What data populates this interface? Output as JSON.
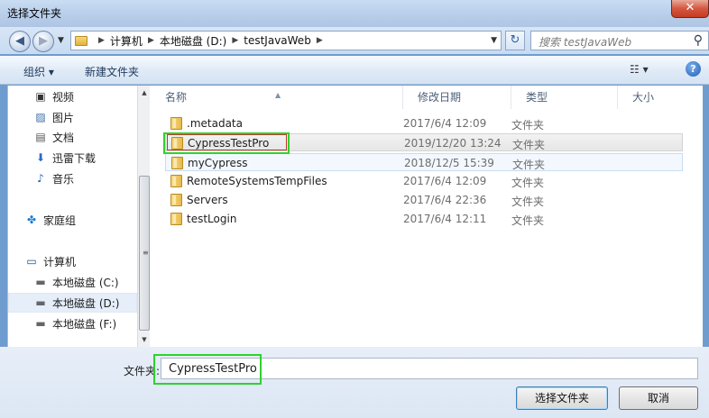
{
  "window": {
    "title": "选择文件夹",
    "close_label": "✕"
  },
  "navigation": {
    "breadcrumbs": [
      "计算机",
      "本地磁盘 (D:)",
      "testJavaWeb"
    ],
    "search_placeholder": "搜索 testJavaWeb"
  },
  "toolbar": {
    "organize_label": "组织 ▾",
    "new_folder_label": "新建文件夹",
    "view_label": "☷ ▾",
    "help_label": "?"
  },
  "sidebar": {
    "items": [
      {
        "label": "视频",
        "icon": "video-icon"
      },
      {
        "label": "图片",
        "icon": "pictures-icon"
      },
      {
        "label": "文档",
        "icon": "documents-icon"
      },
      {
        "label": "迅雷下载",
        "icon": "download-icon"
      },
      {
        "label": "音乐",
        "icon": "music-icon"
      },
      {
        "label": "家庭组",
        "icon": "homegroup-icon"
      },
      {
        "label": "计算机",
        "icon": "computer-icon"
      },
      {
        "label": "本地磁盘 (C:)",
        "icon": "drive-icon"
      },
      {
        "label": "本地磁盘 (D:)",
        "icon": "drive-icon",
        "selected": true
      },
      {
        "label": "本地磁盘 (F:)",
        "icon": "drive-icon"
      }
    ]
  },
  "file_list": {
    "columns": [
      "名称",
      "修改日期",
      "类型",
      "大小"
    ],
    "rows": [
      {
        "name": ".metadata",
        "date": "2017/6/4 12:09",
        "type": "文件夹"
      },
      {
        "name": "CypressTestPro",
        "date": "2019/12/20 13:24",
        "type": "文件夹",
        "state": "selected"
      },
      {
        "name": "myCypress",
        "date": "2018/12/5 15:39",
        "type": "文件夹",
        "state": "hover"
      },
      {
        "name": "RemoteSystemsTempFiles",
        "date": "2017/6/4 12:09",
        "type": "文件夹"
      },
      {
        "name": "Servers",
        "date": "2017/6/4 22:36",
        "type": "文件夹"
      },
      {
        "name": "testLogin",
        "date": "2017/6/4 12:11",
        "type": "文件夹"
      }
    ]
  },
  "footer": {
    "folder_label": "文件夹:",
    "folder_value": "CypressTestPro",
    "ok_label": "选择文件夹",
    "cancel_label": "取消"
  },
  "colors": {
    "highlight_green": "#2fd12f",
    "highlight_red": "#b63a2a"
  }
}
